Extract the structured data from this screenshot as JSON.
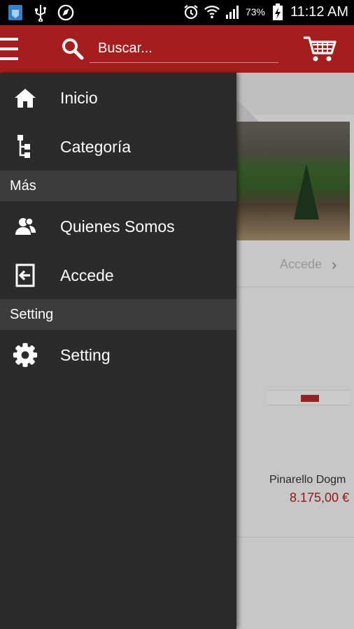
{
  "status_bar": {
    "battery_percent": "73%",
    "time": "11:12 AM",
    "icons": [
      "shield-icon",
      "usb-icon",
      "compass-icon",
      "alarm-icon",
      "wifi-icon",
      "signal-icon",
      "battery-charging-icon"
    ]
  },
  "app_bar": {
    "menu_icon": "menu-icon",
    "search_placeholder": "Buscar...",
    "cart_icon": "cart-icon",
    "color": "#a51d1d"
  },
  "drawer": {
    "items_top": [
      {
        "label": "Inicio",
        "icon": "home-icon"
      },
      {
        "label": "Categoría",
        "icon": "category-tree-icon"
      }
    ],
    "section_more": "Más",
    "items_more": [
      {
        "label": "Quienes Somos",
        "icon": "people-icon"
      },
      {
        "label": "Accede",
        "icon": "login-icon"
      }
    ],
    "section_setting": "Setting",
    "items_setting": [
      {
        "label": "Setting",
        "icon": "gear-icon"
      }
    ]
  },
  "background": {
    "accede_link": "Accede",
    "product_name": "Pinarello Dogm",
    "product_price": "8.175,00 €"
  }
}
